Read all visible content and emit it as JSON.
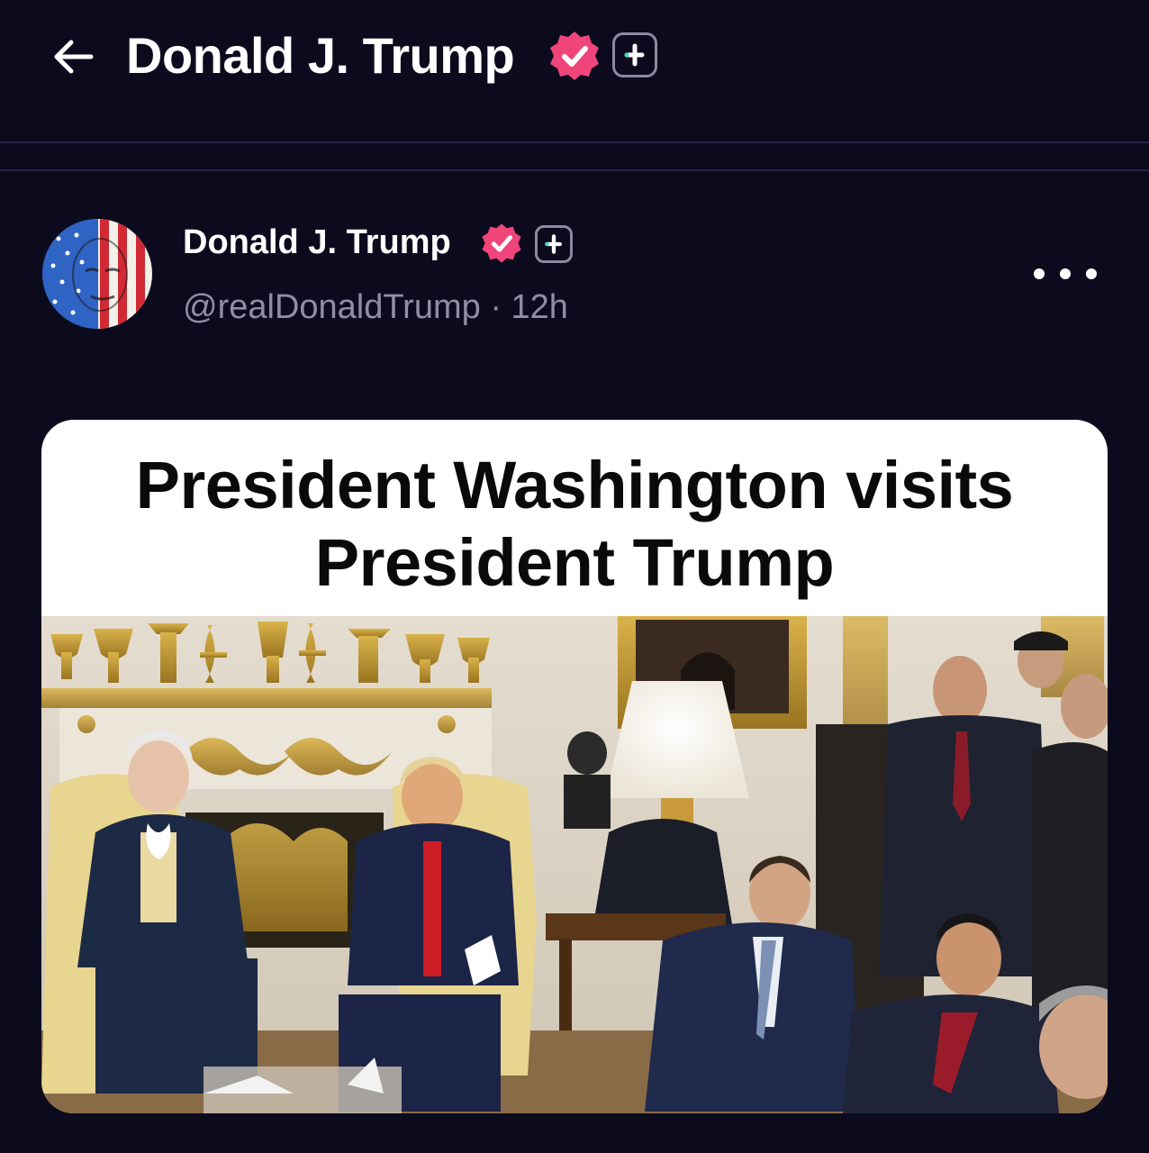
{
  "header": {
    "title": "Donald J. Trump",
    "verified_badge_icon": "verified-badge-icon",
    "plus_icon": "plus-square-icon",
    "back_icon": "arrow-left-icon"
  },
  "post": {
    "author_name": "Donald J. Trump",
    "handle": "@realDonaldTrump",
    "separator": "·",
    "time": "12h",
    "more_icon": "more-horizontal-icon",
    "media": {
      "caption_line1": "President Washington visits",
      "caption_line2": "President Trump"
    }
  },
  "colors": {
    "background": "#0c0b1e",
    "verified_badge": "#f0457a",
    "divider": "#262546",
    "handle_text": "#8f8ea6"
  }
}
